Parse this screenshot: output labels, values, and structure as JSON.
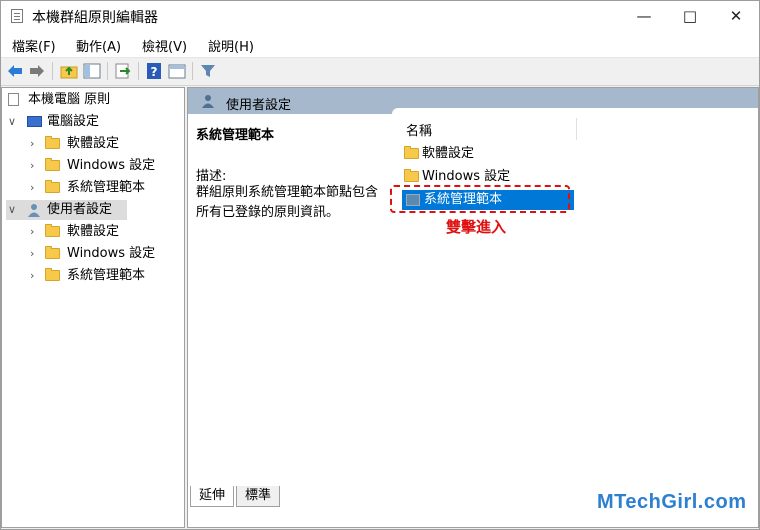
{
  "window": {
    "title": "本機群組原則編輯器"
  },
  "menubar": {
    "items": [
      "檔案(F)",
      "動作(A)",
      "檢視(V)",
      "說明(H)"
    ]
  },
  "tree": {
    "root": "本機電腦 原則",
    "computer": {
      "label": "電腦設定",
      "children": [
        "軟體設定",
        "Windows 設定",
        "系統管理範本"
      ]
    },
    "user": {
      "label": "使用者設定",
      "children": [
        "軟體設定",
        "Windows 設定",
        "系統管理範本"
      ]
    }
  },
  "right": {
    "header": "使用者設定",
    "desc_title": "系統管理範本",
    "desc_label": "描述:",
    "desc_text": "群組原則系統管理範本節點包含所有已登錄的原則資訊。",
    "column": "名稱",
    "items": [
      "軟體設定",
      "Windows 設定",
      "系統管理範本"
    ],
    "annotation": "雙擊進入",
    "tabs": [
      "延伸",
      "標準"
    ]
  },
  "watermark": "MTechGirl.com",
  "colors": {
    "header": "#a5b8cc",
    "selection": "#0078d7",
    "annotation": "#e01010"
  }
}
